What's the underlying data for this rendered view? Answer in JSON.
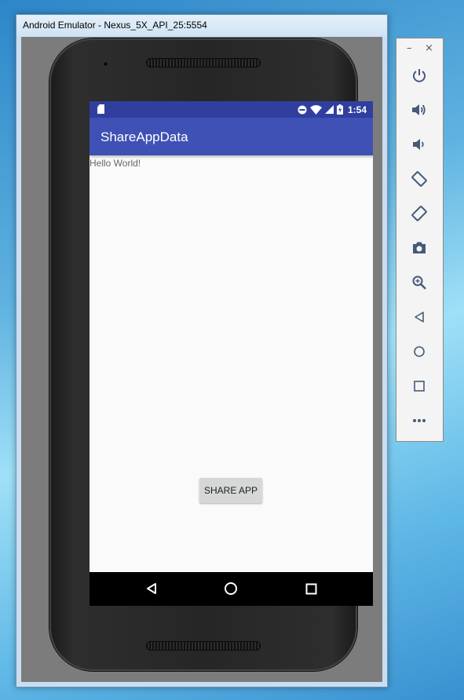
{
  "window": {
    "title": "Android Emulator - Nexus_5X_API_25:5554"
  },
  "status_bar": {
    "time": "1:54",
    "icons": [
      "sd-card-icon",
      "do-not-disturb-icon",
      "wifi-icon",
      "signal-icon",
      "battery-charging-icon"
    ]
  },
  "app": {
    "title": "ShareAppData",
    "hello_text": "Hello World!",
    "share_button_label": "SHARE APP"
  },
  "nav_bar": {
    "buttons": [
      "back-icon",
      "home-icon",
      "recents-icon"
    ]
  },
  "toolbar": {
    "minimize_label": "–",
    "close_label": "×",
    "buttons": [
      "power-icon",
      "volume-up-icon",
      "volume-down-icon",
      "rotate-left-icon",
      "rotate-right-icon",
      "camera-icon",
      "zoom-icon",
      "back-icon",
      "home-icon",
      "overview-icon",
      "more-icon"
    ]
  },
  "colors": {
    "status_bar": "#303f9f",
    "app_bar": "#3f51b5",
    "button": "#d6d7d7",
    "toolbar_icon": "#455a7a"
  }
}
